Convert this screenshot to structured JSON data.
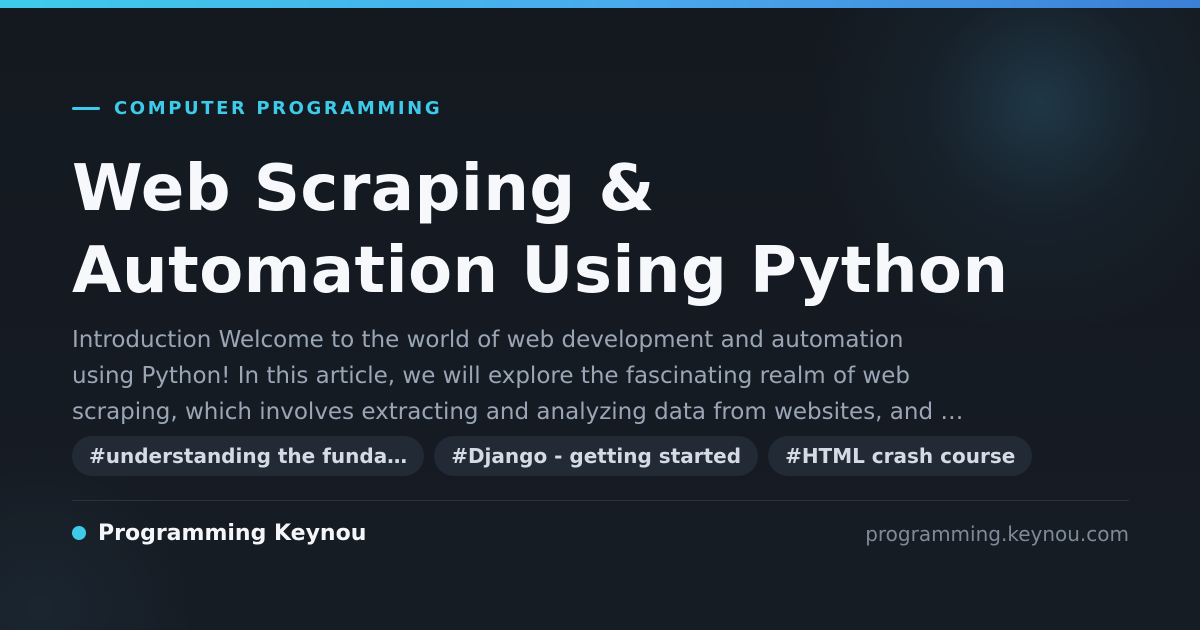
{
  "category": "COMPUTER PROGRAMMING",
  "title_lines": [
    "Web Scraping &",
    "Automation Using Python"
  ],
  "description_lines": [
    "Introduction Welcome to the world of web development and automation",
    "using Python! In this article, we will explore the fascinating realm of web",
    "scraping, which involves extracting and analyzing data from websites, and …"
  ],
  "tags": [
    "#understanding the funda…",
    "#Django - getting started",
    "#HTML crash course"
  ],
  "brand": "Programming Keynou",
  "site": "programming.keynou.com",
  "colors": {
    "accent": "#3ecbea",
    "background": "#151a22",
    "title": "#f7f8fb",
    "description": "#9aa6b6",
    "tag_background": "#222a35",
    "muted": "#7f8a99"
  }
}
